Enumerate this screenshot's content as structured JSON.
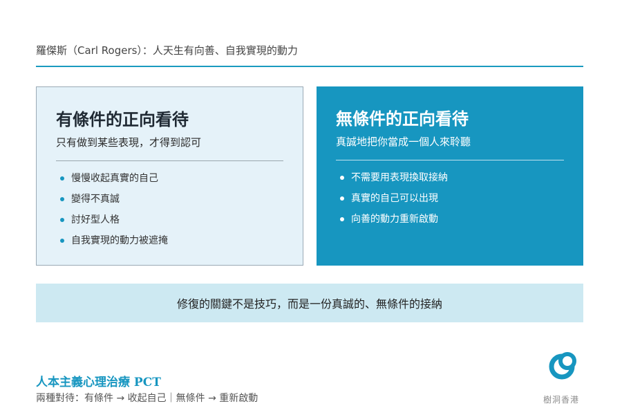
{
  "header": {
    "title": "羅傑斯（Carl Rogers）：人天生有向善、自我實現的動力"
  },
  "cards": {
    "left": {
      "title": "有條件的正向看待",
      "subtitle": "只有做到某些表現，才得到認可",
      "items": [
        "慢慢收起真實的自己",
        "變得不真誠",
        "討好型人格",
        "自我實現的動力被遮掩"
      ]
    },
    "right": {
      "title": "無條件的正向看待",
      "subtitle": "真誠地把你當成一個人來聆聽",
      "items": [
        "不需要用表現換取接納",
        "真實的自己可以出現",
        "向善的動力重新啟動"
      ]
    }
  },
  "banner": {
    "text": "修復的關鍵不是技巧，而是一份真誠的、無條件的接納"
  },
  "footer": {
    "title": "人本主義心理治療 PCT",
    "subtitle": "兩種對待：有條件 → 收起自己｜無條件 → 重新啟動",
    "brand": "樹洞香港"
  },
  "colors": {
    "accent": "#1796c0",
    "left_card_bg": "#e5f2f9",
    "banner_bg": "#cde9f2"
  }
}
